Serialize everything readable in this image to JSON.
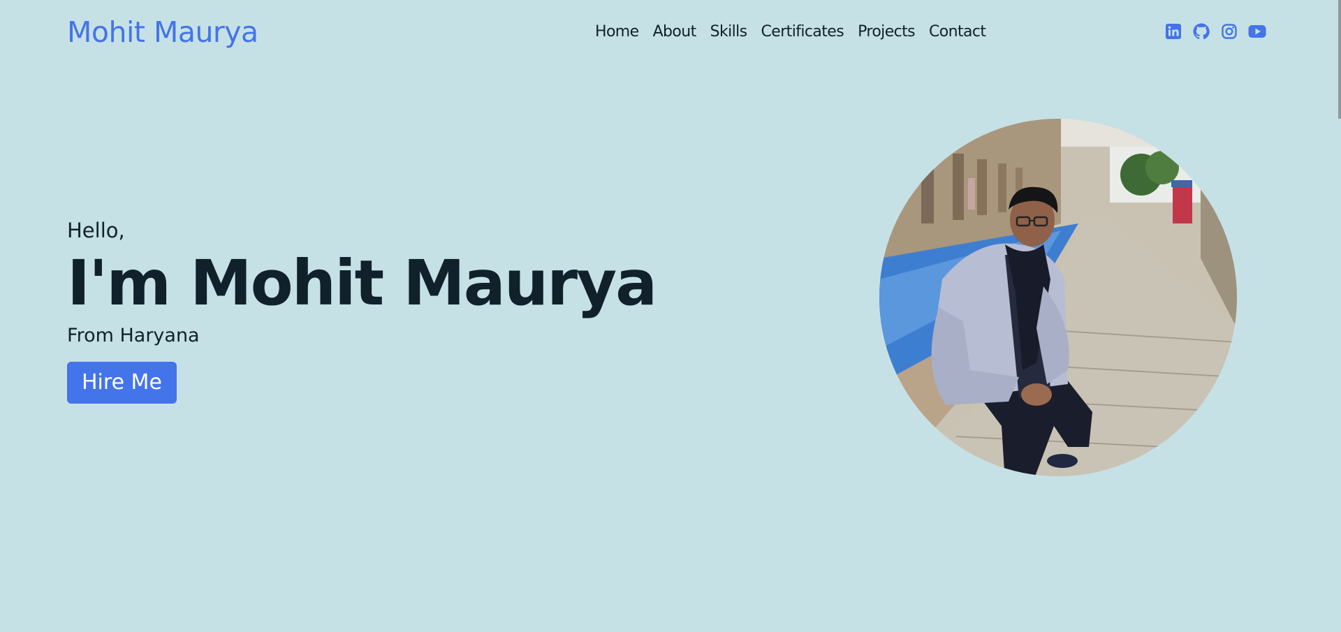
{
  "brand": {
    "name": "Mohit Maurya"
  },
  "nav": {
    "items": [
      {
        "label": "Home"
      },
      {
        "label": "About"
      },
      {
        "label": "Skills"
      },
      {
        "label": "Certificates"
      },
      {
        "label": "Projects"
      },
      {
        "label": "Contact"
      }
    ]
  },
  "social": {
    "icons": [
      "linkedin-icon",
      "github-icon",
      "instagram-icon",
      "youtube-icon"
    ],
    "color": "#4474ea"
  },
  "hero": {
    "greeting": "Hello,",
    "headline": "I'm Mohit Maurya",
    "location": "From Haryana",
    "cta_label": "Hire Me"
  },
  "theme": {
    "background": "#c6e1e5",
    "accent": "#4474ea",
    "text": "#10212b"
  }
}
